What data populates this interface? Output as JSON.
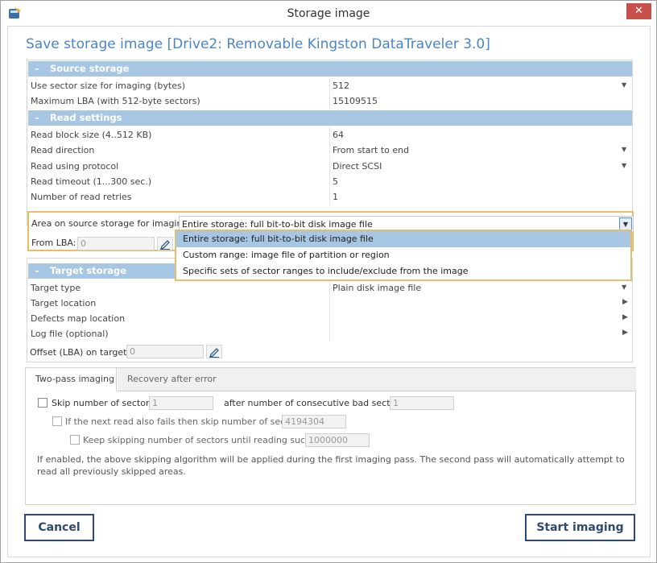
{
  "window": {
    "title": "Storage image",
    "close_glyph": "✕"
  },
  "heading": "Save storage image [Drive2: Removable Kingston DataTraveler 3.0]",
  "source_storage": {
    "title": "Source storage",
    "rows": [
      {
        "label": "Use sector size for imaging (bytes)",
        "value": "512"
      },
      {
        "label": "Maximum LBA (with 512-byte sectors)",
        "value": "15109515"
      }
    ]
  },
  "read_settings": {
    "title": "Read settings",
    "rows": [
      {
        "label": "Read block size (4..512 KB)",
        "value": "64"
      },
      {
        "label": "Read direction",
        "value": "From start to end"
      },
      {
        "label": "Read using protocol",
        "value": "Direct SCSI"
      },
      {
        "label": "Read timeout (1...300 sec.)",
        "value": "5"
      },
      {
        "label": "Number of read retries",
        "value": "1"
      }
    ]
  },
  "area": {
    "label": "Area on source storage for imaging:",
    "selected": "Entire storage: full bit-to-bit disk image file",
    "from_lba_label": "From LBA:",
    "from_lba_value": "0",
    "options": [
      "Entire storage: full bit-to-bit disk image file",
      "Custom range: image file of partition or region",
      "Specific sets of sector ranges to include/exclude from the image"
    ]
  },
  "target_storage": {
    "title": "Target storage",
    "rows": [
      {
        "label": "Target type",
        "value": "Plain disk image file"
      },
      {
        "label": "Target location",
        "value": ""
      },
      {
        "label": "Defects map location",
        "value": ""
      },
      {
        "label": "Log file (optional)",
        "value": ""
      }
    ],
    "offset_label": "Offset (LBA) on target:",
    "offset_value": "0"
  },
  "tabs": [
    {
      "label": "Two-pass imaging"
    },
    {
      "label": "Recovery after error"
    }
  ],
  "two_pass": {
    "skip_label": "Skip number of sectors:",
    "skip_value": "1",
    "after_label": "after number of consecutive bad sectors:",
    "after_value": "1",
    "next_label": "If the next read also fails then skip number of sectors:",
    "next_value": "4194304",
    "keep_label": "Keep skipping number of sectors until reading succeeds:",
    "keep_value": "1000000",
    "note": "If enabled, the above skipping algorithm will be applied during the first imaging pass. The second pass will automatically attempt to read all previously skipped areas."
  },
  "buttons": {
    "cancel": "Cancel",
    "start": "Start imaging"
  },
  "colors": {
    "accent": "#4a86c3",
    "section": "#a7c6e3",
    "highlight": "#e2be6e",
    "close": "#c7504b",
    "button_text": "#2d4a6e"
  },
  "icons": {
    "app": "app-disk-icon",
    "dropdown": "triangle-down-icon",
    "expand": "triangle-right-icon",
    "edit": "pencil-icon"
  }
}
